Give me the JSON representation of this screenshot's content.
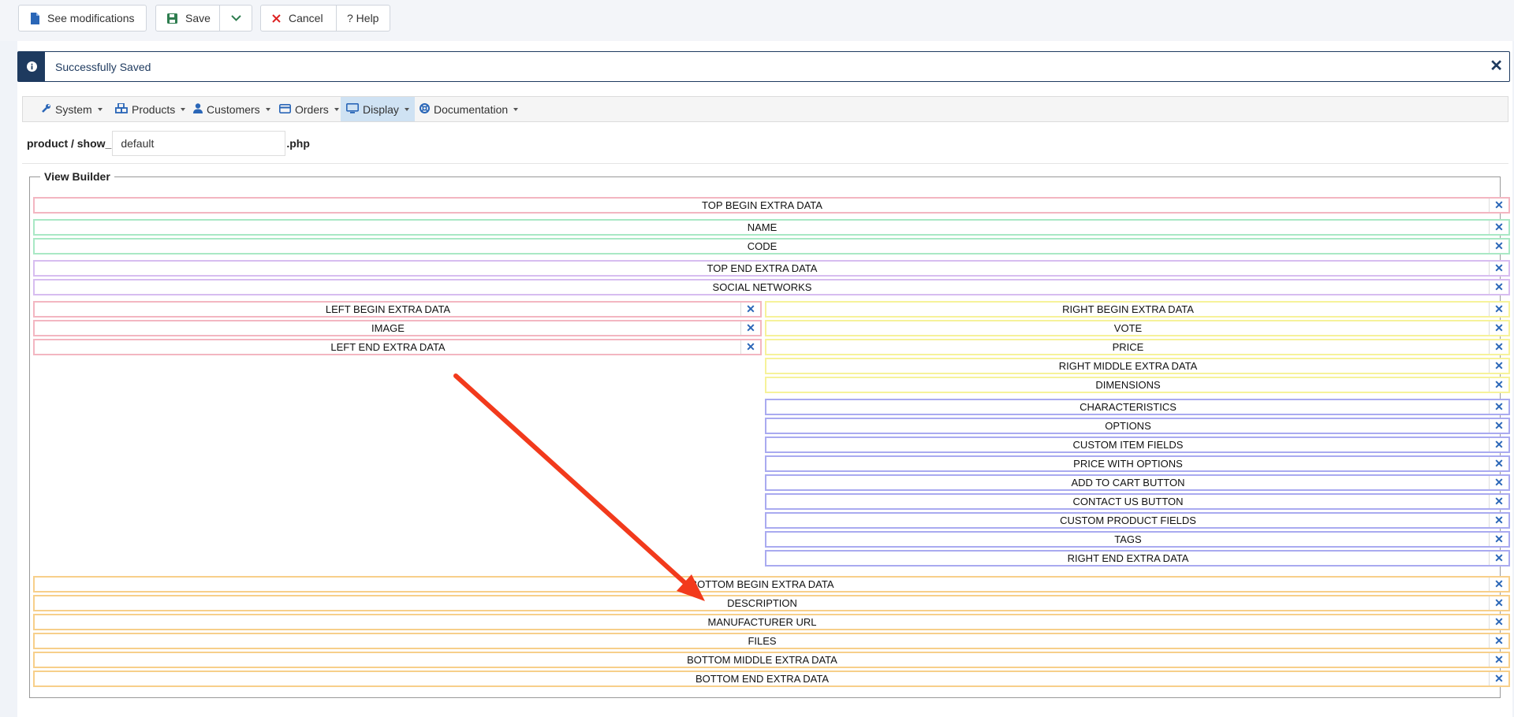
{
  "toolbar": {
    "see_modifications": "See modifications",
    "save": "Save",
    "cancel": "Cancel",
    "help": "? Help"
  },
  "alert": {
    "message": "Successfully Saved",
    "close": "✕"
  },
  "nav": {
    "items": [
      {
        "label": "System"
      },
      {
        "label": "Products"
      },
      {
        "label": "Customers"
      },
      {
        "label": "Orders"
      },
      {
        "label": "Display",
        "active": true
      },
      {
        "label": "Documentation"
      }
    ]
  },
  "file": {
    "prefix": "product / show_",
    "value": "default",
    "suffix": ".php"
  },
  "view_builder": {
    "title": "View Builder",
    "remove_symbol": "✕",
    "top": [
      {
        "label": "TOP BEGIN EXTRA DATA",
        "color": "#f3b6c1"
      },
      {
        "label": "NAME",
        "color": "#a9e8c5"
      },
      {
        "label": "CODE",
        "color": "#a9e8c5"
      },
      {
        "label": "TOP END EXTRA DATA",
        "color": "#d7bdf0"
      },
      {
        "label": "SOCIAL NETWORKS",
        "color": "#d7bdf0"
      }
    ],
    "left": [
      {
        "label": "LEFT BEGIN EXTRA DATA",
        "color": "#f3b6c1"
      },
      {
        "label": "IMAGE",
        "color": "#f3b6c1"
      },
      {
        "label": "LEFT END EXTRA DATA",
        "color": "#f3b6c1"
      }
    ],
    "right_a": [
      {
        "label": "RIGHT BEGIN EXTRA DATA",
        "color": "#f6f29a"
      },
      {
        "label": "VOTE",
        "color": "#f6f29a"
      },
      {
        "label": "PRICE",
        "color": "#f6f29a"
      },
      {
        "label": "RIGHT MIDDLE EXTRA DATA",
        "color": "#f6f29a"
      },
      {
        "label": "DIMENSIONS",
        "color": "#f6f29a"
      }
    ],
    "right_b": [
      {
        "label": "CHARACTERISTICS",
        "color": "#a9aaf0"
      },
      {
        "label": "OPTIONS",
        "color": "#a9aaf0"
      },
      {
        "label": "CUSTOM ITEM FIELDS",
        "color": "#a9aaf0"
      },
      {
        "label": "PRICE WITH OPTIONS",
        "color": "#a9aaf0"
      },
      {
        "label": "ADD TO CART BUTTON",
        "color": "#a9aaf0"
      },
      {
        "label": "CONTACT US BUTTON",
        "color": "#a9aaf0"
      },
      {
        "label": "CUSTOM PRODUCT FIELDS",
        "color": "#a9aaf0"
      },
      {
        "label": "TAGS",
        "color": "#a9aaf0"
      },
      {
        "label": "RIGHT END EXTRA DATA",
        "color": "#a9aaf0"
      }
    ],
    "bottom": [
      {
        "label": "BOTTOM BEGIN EXTRA DATA",
        "color": "#f7cf8a"
      },
      {
        "label": "DESCRIPTION",
        "color": "#f7cf8a"
      },
      {
        "label": "MANUFACTURER URL",
        "color": "#f7cf8a"
      },
      {
        "label": "FILES",
        "color": "#f7cf8a"
      },
      {
        "label": "BOTTOM MIDDLE EXTRA DATA",
        "color": "#f7cf8a"
      },
      {
        "label": "BOTTOM END EXTRA DATA",
        "color": "#f7cf8a"
      }
    ]
  },
  "annotation": {
    "arrow_color": "#f23a1c"
  }
}
